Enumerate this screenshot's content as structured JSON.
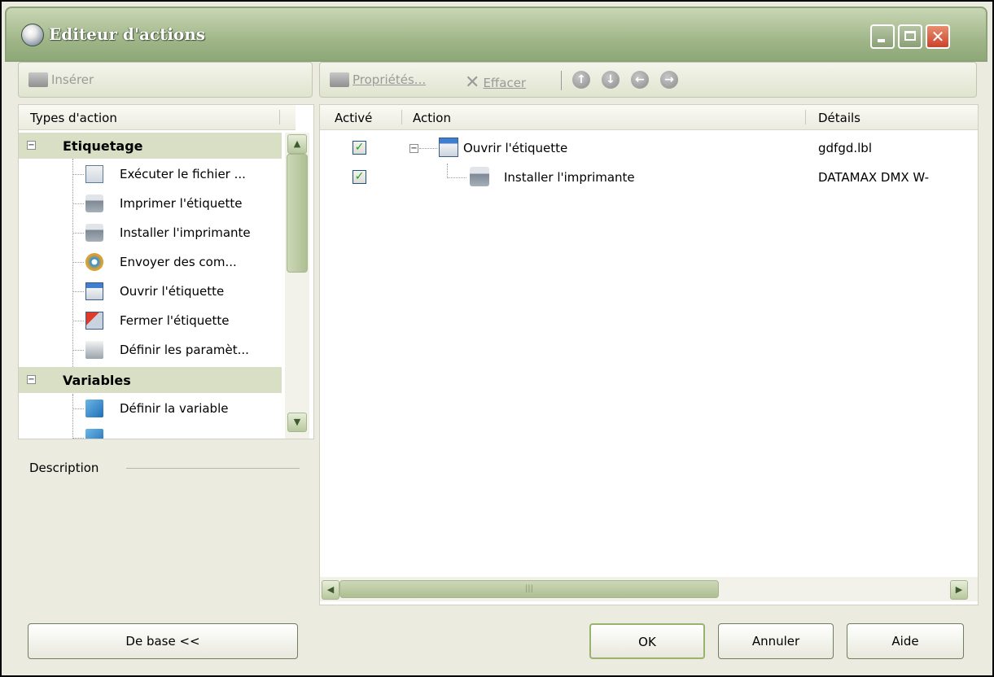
{
  "window": {
    "title": "Editeur d'actions"
  },
  "left_toolbar": {
    "insert_label": "Insérer"
  },
  "right_toolbar": {
    "properties_label": "Propriétés...",
    "delete_label": "Effacer",
    "nav": [
      "up",
      "down",
      "left",
      "right"
    ]
  },
  "action_types": {
    "header": "Types d'action",
    "groups": [
      {
        "label": "Etiquetage",
        "items": [
          {
            "label": "Exécuter le fichier ...",
            "icon": "run-file-icon"
          },
          {
            "label": "Imprimer l'étiquette",
            "icon": "printer-icon"
          },
          {
            "label": "Installer l'imprimante",
            "icon": "install-printer-icon"
          },
          {
            "label": "Envoyer des com...",
            "icon": "send-commands-icon"
          },
          {
            "label": "Ouvrir l'étiquette",
            "icon": "open-label-icon"
          },
          {
            "label": "Fermer l'étiquette",
            "icon": "close-label-icon"
          },
          {
            "label": "Définir les paramèt...",
            "icon": "settings-icon"
          }
        ]
      },
      {
        "label": "Variables",
        "items": [
          {
            "label": "Définir la variable",
            "icon": "variable-icon"
          }
        ]
      }
    ]
  },
  "description": {
    "label": "Description"
  },
  "actions_list": {
    "columns": [
      "Activé",
      "Action",
      "Détails"
    ],
    "rows": [
      {
        "enabled": true,
        "action": "Ouvrir l'étiquette",
        "details": "gdfgd.lbl",
        "level": 0
      },
      {
        "enabled": true,
        "action": "Installer l'imprimante",
        "details": "DATAMAX DMX W-",
        "level": 1
      }
    ]
  },
  "buttons": {
    "basic": "De base <<",
    "ok": "OK",
    "cancel": "Annuler",
    "help": "Aide"
  }
}
